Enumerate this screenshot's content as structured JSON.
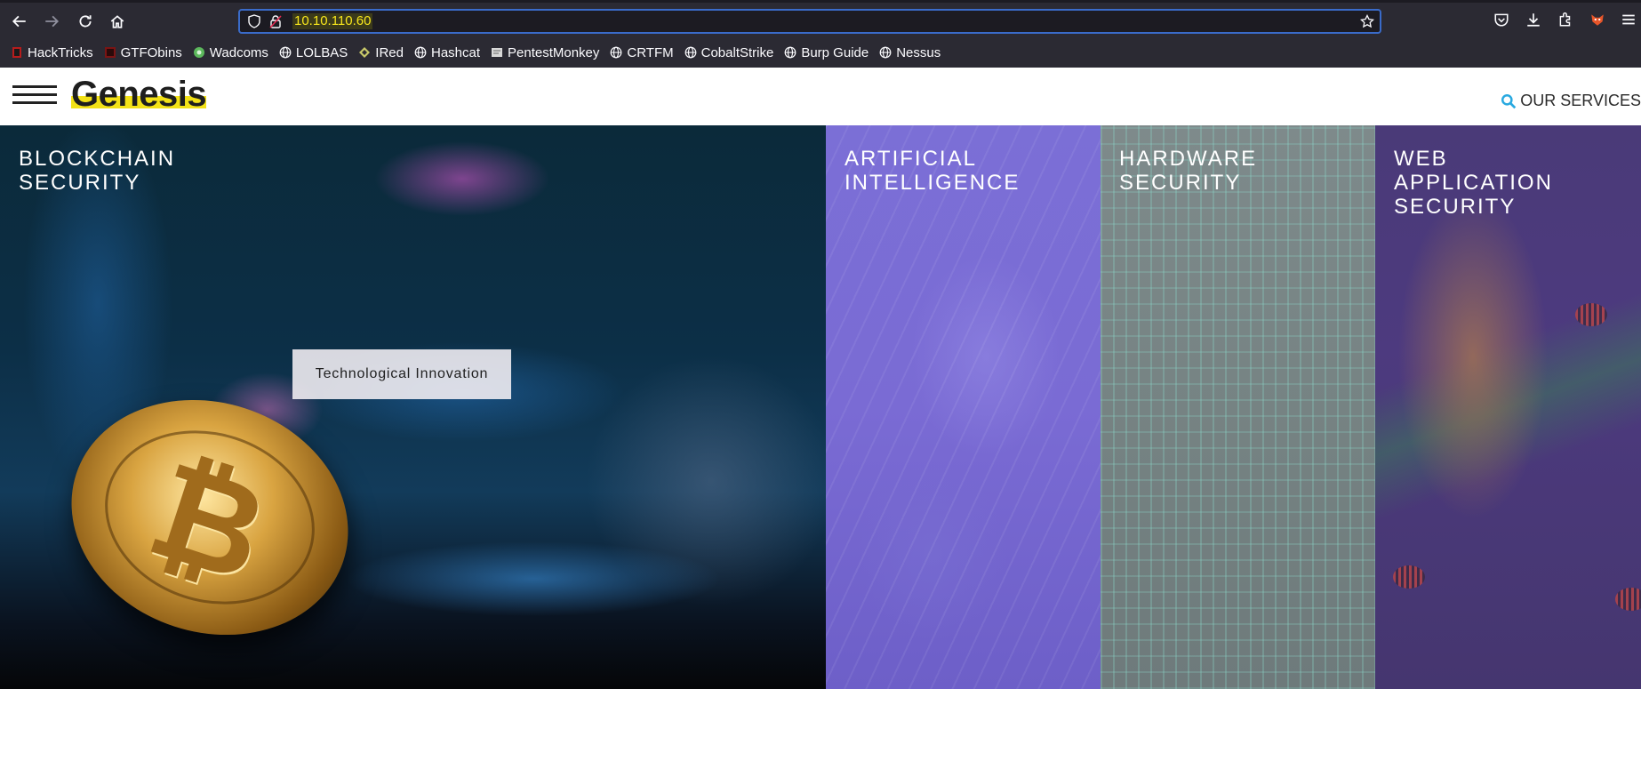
{
  "browser": {
    "url": "10.10.110.60",
    "bookmarks": [
      {
        "label": "HackTricks",
        "icon": "hacktricks-icon"
      },
      {
        "label": "GTFObins",
        "icon": "gtfobins-icon"
      },
      {
        "label": "Wadcoms",
        "icon": "wadcoms-icon"
      },
      {
        "label": "LOLBAS",
        "icon": "globe-icon"
      },
      {
        "label": "IRed",
        "icon": "ired-icon"
      },
      {
        "label": "Hashcat",
        "icon": "globe-icon"
      },
      {
        "label": "PentestMonkey",
        "icon": "pentestmonkey-icon"
      },
      {
        "label": "CRTFM",
        "icon": "globe-icon"
      },
      {
        "label": "CobaltStrike",
        "icon": "globe-icon"
      },
      {
        "label": "Burp Guide",
        "icon": "globe-icon"
      },
      {
        "label": "Nessus",
        "icon": "globe-icon"
      }
    ]
  },
  "header": {
    "logo": "Genesis",
    "services_label": "OUR SERVICES"
  },
  "panels": [
    {
      "title": "BLOCKCHAIN\nSECURITY"
    },
    {
      "title": "ARTIFICIAL\nINTELLIGENCE"
    },
    {
      "title": "HARDWARE\nSECURITY"
    },
    {
      "title": "WEB\nAPPLICATION\nSECURITY"
    }
  ],
  "hero": {
    "badge": "Technological Innovation"
  },
  "colors": {
    "accent_yellow": "#f3e217",
    "services_icon": "#29a9e0",
    "ai_panel": "#7b6fd6",
    "hardware_panel": "#7e8a8b",
    "web_panel": "#4a3a78"
  }
}
